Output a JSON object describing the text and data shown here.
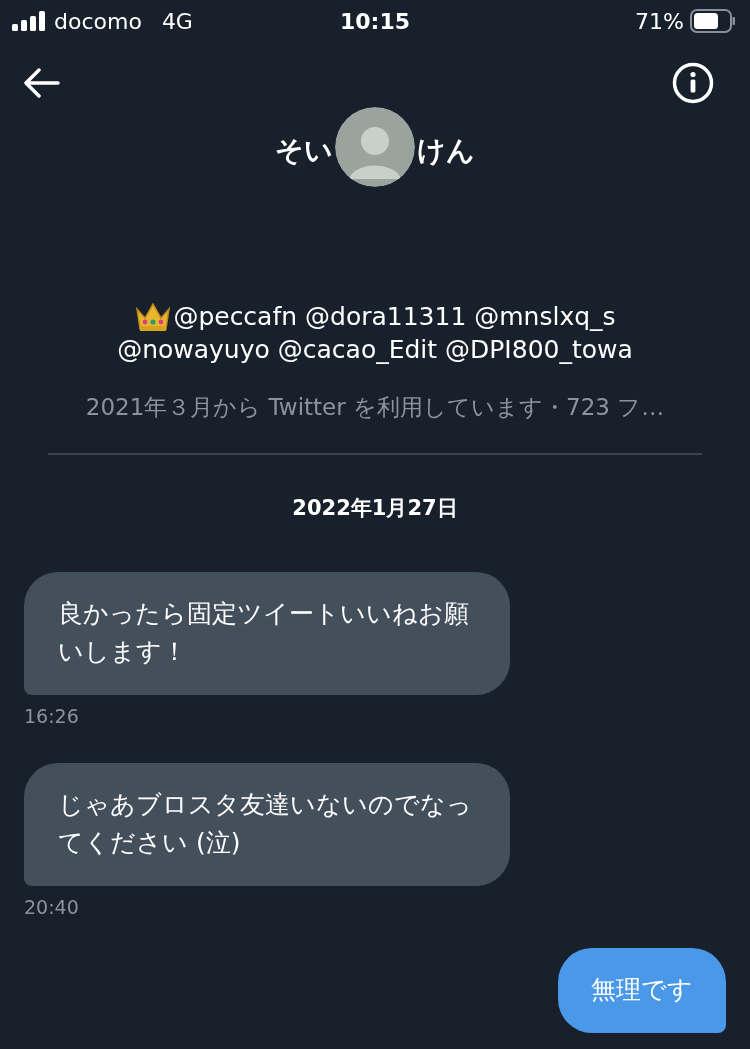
{
  "status_bar": {
    "carrier": "docomo",
    "network": "4G",
    "time": "10:15",
    "battery": "71%"
  },
  "header": {
    "title_start": "そい",
    "title_end": "けん"
  },
  "profile": {
    "bio_lines": [
      "@peccafn @dora11311 @mnslxq_s",
      "@nowayuyo @cacao_Edit @DPI800_towa"
    ],
    "joined": "2021年３月から Twitter を利用しています・723 フ…"
  },
  "date": "2022年1月27日",
  "messages": [
    {
      "kind": "received",
      "text": "良かったら固定ツイートいいねお願いします！",
      "time": "16:26"
    },
    {
      "kind": "received",
      "text": "じゃあブロスタ友達いないのでなってください (泣)",
      "time": "20:40"
    },
    {
      "kind": "sent",
      "text": "無理です"
    }
  ]
}
